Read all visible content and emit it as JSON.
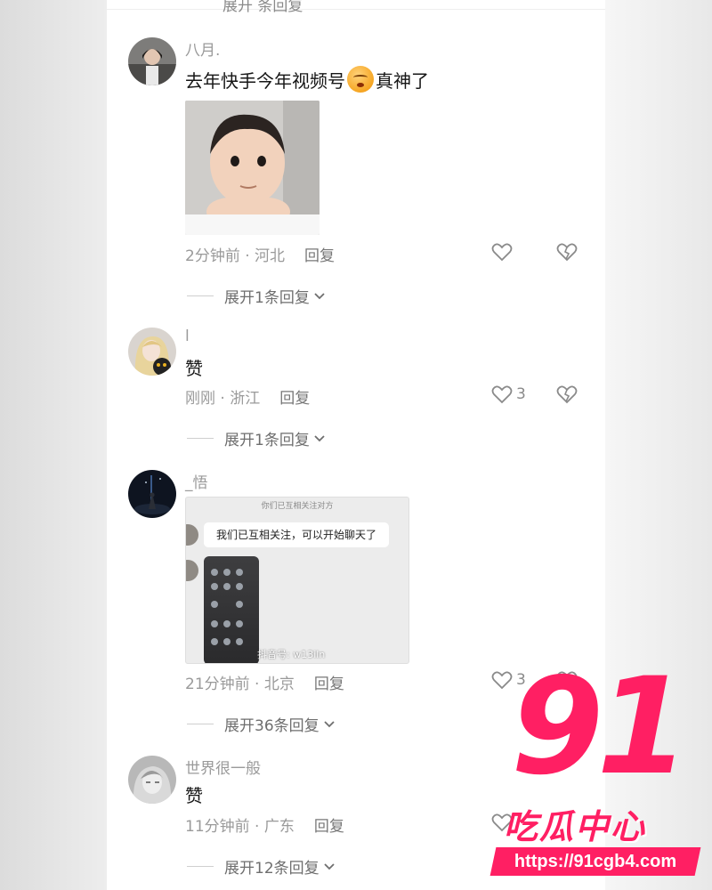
{
  "top_stub": "展开  条回复",
  "comments": [
    {
      "user": "八月.",
      "text": "去年快手今年视频号",
      "text_after": "真神了",
      "emoji_icon": "sleepy-face-emoji",
      "time": "2分钟前 · 河北",
      "reply": "回复",
      "likes": "",
      "expand": "展开1条回复"
    },
    {
      "user": "l",
      "text": "赞",
      "time": "刚刚 · 浙江",
      "reply": "回复",
      "likes": "3",
      "expand": "展开1条回复"
    },
    {
      "user": "_悟",
      "image": {
        "caption": "你们已互相关注对方",
        "bubble": "我们已互相关注，可以开始聊天了",
        "watermark": "抖音号: w13iln"
      },
      "time": "21分钟前 · 北京",
      "reply": "回复",
      "likes": "3",
      "expand": "展开36条回复"
    },
    {
      "user": "世界很一般",
      "text": "赞",
      "time": "11分钟前 · 广东",
      "reply": "回复",
      "likes": "",
      "expand": "展开12条回复"
    }
  ],
  "logo": {
    "number": "91",
    "name": "吃瓜中心",
    "url": "https://91cgb4.com",
    "color": "#ff1f63"
  }
}
